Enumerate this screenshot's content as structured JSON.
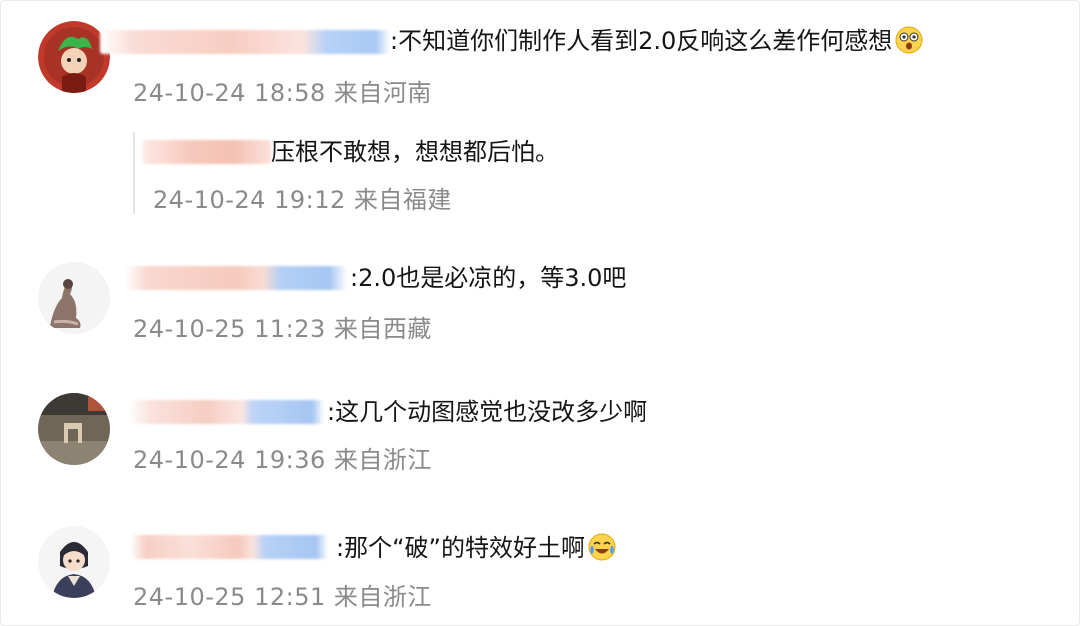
{
  "comments": [
    {
      "text": ":不知道你们制作人看到2.0反响这么差作何感想",
      "emoji": "shocked-face-emoji",
      "time": "24-10-24 18:58",
      "location": "来自河南"
    },
    {
      "text": "压根不敢想，想想都后怕。",
      "time": "24-10-24 19:12",
      "location": "来自福建"
    },
    {
      "text": ":2.0也是必凉的，等3.0吧",
      "time": "24-10-25 11:23",
      "location": "来自西藏"
    },
    {
      "text": ":这几个动图感觉也没改多少啊",
      "time": "24-10-24 19:36",
      "location": "来自浙江"
    },
    {
      "text": ":那个“破”的特效好土啊",
      "emoji": "laughing-crying-emoji",
      "time": "24-10-25 12:51",
      "location": "来自浙江"
    }
  ],
  "colors": {
    "text": "#151515",
    "meta": "#8a8a8a",
    "blur_pink": "#f6c6bc",
    "blur_blue": "#a9c8f4"
  }
}
